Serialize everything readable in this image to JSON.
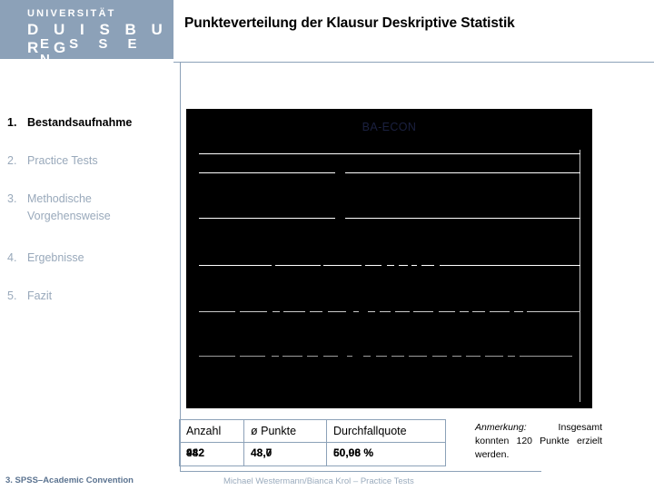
{
  "logo": {
    "line1": "UNIVERSITÄT",
    "line2": "D U I S B U R G",
    "line3": "E S S E N",
    "bg_color": "#8ca1b8"
  },
  "header": {
    "title": "Punkteverteilung der Klausur Deskriptive Statistik",
    "accent_color": "#8ca1b8"
  },
  "agenda": {
    "items": [
      {
        "num": "1.",
        "label": "Bestandsaufnahme",
        "state": "active"
      },
      {
        "num": "2.",
        "label": "Practice Tests",
        "state": "dim"
      },
      {
        "num": "3.",
        "label": "Methodische Vorgehensweise",
        "state": "dim"
      },
      {
        "num": "4.",
        "label": "Ergebnisse",
        "state": "dim"
      },
      {
        "num": "5.",
        "label": "Fazit",
        "state": "dim"
      }
    ],
    "active_color": "#000000",
    "dim_color": "#99a9bb"
  },
  "chart_data": {
    "type": "bar",
    "title": "BA-ECON",
    "title_color": "#1b2140",
    "background": "#000000",
    "xlabel": "",
    "ylabel": "",
    "categories": [],
    "values": [],
    "grid": true,
    "legend": "none",
    "note": "Chart plotted on a black background; the plotted series and axis tick labels render black-on-black and are not legible, only the white gridlines and the chart title are visible."
  },
  "results_table": {
    "headers": [
      "Anzahl",
      "ø Punkte",
      "Durchfallquote"
    ],
    "values": {
      "anzahl": "982",
      "anzahl_overlay": "442",
      "punkte": "48,0",
      "punkte_overlay": "43,7",
      "quote": "60,06 %",
      "quote_overlay": "50,98 %"
    },
    "border_color": "#8ca1b8"
  },
  "note": {
    "label": "Anmerkung:",
    "text": " Insgesamt konnten 120 Punkte erzielt werden."
  },
  "footer": {
    "left": "3. SPSS–Academic Convention",
    "center": "Michael Westermann/Bianca Krol – Practice Tests",
    "left_color": "#5b7390",
    "center_color": "#9aabbd"
  }
}
